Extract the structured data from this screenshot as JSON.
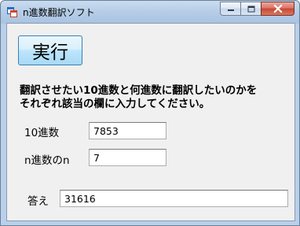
{
  "window": {
    "title": "n進数翻訳ソフト",
    "accent": "#3c7fb1",
    "close_color": "#c9452f"
  },
  "controls": {
    "run_label": "実行"
  },
  "instructions": {
    "line1": "翻訳させたい10進数と何進数に翻訳したいのかを",
    "line2": "それぞれ該当の欄に入力してください。"
  },
  "fields": {
    "decimal_label": "10進数",
    "decimal_value": "7853",
    "base_label": "n進数のn",
    "base_value": "7",
    "answer_label": "答え",
    "answer_value": "31616"
  },
  "icons": {
    "app": "app-icon",
    "minimize": "minimize-icon",
    "maximize": "maximize-icon",
    "close": "close-icon"
  }
}
